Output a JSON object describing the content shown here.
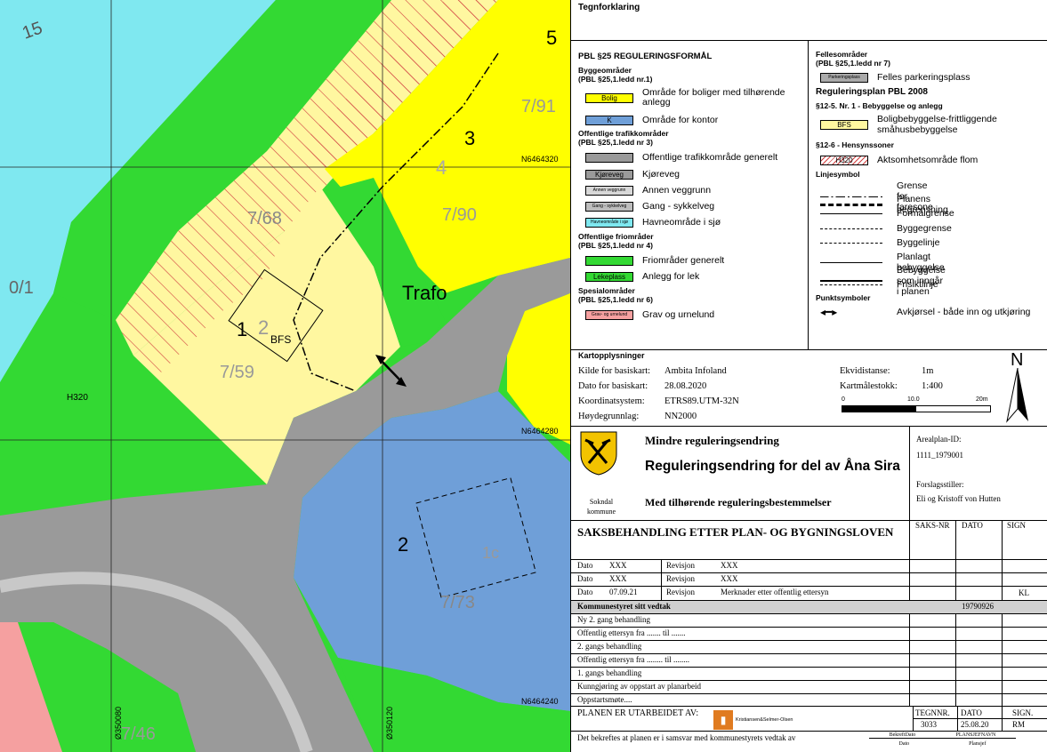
{
  "map": {
    "labels": {
      "lot_15": "15",
      "lot_01": "0/1",
      "lot_768": "7/68",
      "lot_1": "1",
      "lot_2_small": "2",
      "bfs": "BFS",
      "lot_759": "7/59",
      "h320": "H320",
      "trafo": "Trafo",
      "lot_5": "5",
      "lot_791": "7/91",
      "lot_3": "3",
      "lot_4": "4",
      "lot_790": "7/90",
      "n6464320": "N6464320",
      "n6464280": "N6464280",
      "n6464240": "N6464240",
      "lot_2_big": "2",
      "lot_1c": "1c",
      "lot_773": "7/73",
      "lot_746": "7/46",
      "e350080": "Ø350080",
      "e350120": "Ø350120"
    },
    "colors": {
      "sea": "#7fe8f0",
      "green": "#33d933",
      "yellow_light": "#fff7a0",
      "yellow": "#ffff00",
      "road": "#9a9a9a",
      "blue": "#6f9fd8",
      "pink": "#f5a0a0",
      "hatch": "#d04040"
    }
  },
  "legend": {
    "title": "Tegnforklaring",
    "pbl_title": "PBL §25 REGULERINGSFORMÅL",
    "byggeomrader": "Byggeområder",
    "byggeomrader_ref": "(PBL §25,1.ledd nr.1)",
    "bolig_swatch": "Bolig",
    "bolig_text": "Område for boliger med tilhørende anlegg",
    "k_swatch": "K",
    "k_text": "Område for kontor",
    "trafikk": "Offentlige trafikkområder",
    "trafikk_ref": "(PBL §25,1.ledd nr 3)",
    "trafikk_text": "Offentlige trafikkområde generelt",
    "kjoreveg_swatch": "Kjøreveg",
    "kjoreveg_text": "Kjøreveg",
    "annen_swatch": "Annen veggrunn",
    "annen_text": "Annen veggrunn",
    "gang_swatch": "Gang - sykkelveg",
    "gang_text": "Gang - sykkelveg",
    "havn_swatch": "Havneområde i sjø",
    "havn_text": "Havneområde i sjø",
    "friomrader": "Offentlige friområder",
    "friomrader_ref": "(PBL §25,1.ledd nr 4)",
    "fri_text": "Friområder generelt",
    "lek_swatch": "Lekeplass",
    "lek_text": "Anlegg for lek",
    "spesial": "Spesialområder",
    "spesial_ref": "(PBL §25,1.ledd nr 6)",
    "grav_swatch": "Grav- og urnelund",
    "grav_text": "Grav og urnelund",
    "felles": "Fellesområder",
    "felles_ref": "(PBL §25,1.ledd nr 7)",
    "park_swatch": "Parkeringsplass",
    "park_text": "Felles parkeringsplass",
    "regplan": "Reguleringsplan PBL 2008",
    "sec125": "§12-5. Nr. 1 - Bebyggelse og anlegg",
    "bfs_swatch": "BFS",
    "bfs_text": "Boligbebyggelse-frittliggende småhusbebyggelse",
    "sec126": "§12-6 - Hensynssoner",
    "h320_swatch": "H320",
    "h320_text": "Aktsomhetsområde flom",
    "linjesymbol": "Linjesymbol",
    "lines": [
      "Grense for faresone",
      "Planens begrensning",
      "Formålgrense",
      "Byggegrense",
      "Byggelinje",
      "Planlagt bebyggelse",
      "Bebyggelse som inngår i planen",
      "Frisiktlinje"
    ],
    "punktsymboler": "Punktsymboler",
    "avkjorsel_text": "Avkjørsel - både inn og utkjøring"
  },
  "kart": {
    "title": "Kartopplysninger",
    "kilde_label": "Kilde for basiskart:",
    "kilde_value": "Ambita Infoland",
    "dato_label": "Dato for basiskart:",
    "dato_value": "28.08.2020",
    "koord_label": "Koordinatsystem:",
    "koord_value": "ETRS89.UTM-32N",
    "hoyde_label": "Høydegrunnlag:",
    "hoyde_value": "NN2000",
    "ekvi_label": "Ekvidistanse:",
    "ekvi_value": "1m",
    "maal_label": "Kartmålestokk:",
    "maal_value": "1:400",
    "scale_0": "0",
    "scale_10": "10.0",
    "scale_20": "20m",
    "north": "N"
  },
  "title": {
    "kommune": "Sokndal kommune",
    "mindre": "Mindre reguleringsendring",
    "main": "Reguleringsendring for del av Åna Sira",
    "sub": "Med tilhørende reguleringsbestemmelser",
    "arealplan_label": "Arealplan-ID:",
    "arealplan_value": "1111_1979001",
    "forslag_label": "Forslagsstiller:",
    "forslag_value": "Eli og Kristoff von Hutten"
  },
  "saks": {
    "heading": "SAKSBEHANDLING ETTER PLAN- OG BYGNINGSLOVEN",
    "col_saksnr": "SAKS-NR",
    "col_dato": "DATO",
    "col_sign": "SIGN",
    "revisions": [
      {
        "dato_label": "Dato",
        "dato": "XXX",
        "rev_label": "Revisjon",
        "rev": "XXX",
        "sign": ""
      },
      {
        "dato_label": "Dato",
        "dato": "XXX",
        "rev_label": "Revisjon",
        "rev": "XXX",
        "sign": ""
      },
      {
        "dato_label": "Dato",
        "dato": "07.09.21",
        "rev_label": "Revisjon",
        "rev": "Merknader etter offentlig ettersyn",
        "sign": "KL"
      }
    ],
    "vedtak_label": "Kommunestyret sitt vedtak",
    "vedtak_dato": "19790926",
    "steps": [
      "Ny 2. gang behandling",
      "Offentlig ettersyn fra ....... til .......",
      "2. gangs behandling",
      "Offentlig ettersyn fra ........ til ........",
      "1. gangs behandling",
      "Kunngjøring av oppstart av planarbeid",
      "Oppstartsmøte...."
    ],
    "utarbeidet_label": "PLANEN ER UTARBEIDET AV:",
    "firm_name": "Kristiansen&Selmer-Olsen",
    "tegnnr_label": "TEGNNR.",
    "tegnnr_value": "3033",
    "dato_label": "DATO",
    "dato_value": "25.08.20",
    "sign_label": "SIGN.",
    "sign_value": "RM",
    "bekreftes": "Det bekreftes at planen er i samsvar med kommunestyrets vedtak av",
    "bek_dato": "BekreftDato",
    "bek_plan": "PLANSJEFNAVN",
    "bek_dato2": "Dato",
    "bek_plan2": "Plansjef"
  }
}
